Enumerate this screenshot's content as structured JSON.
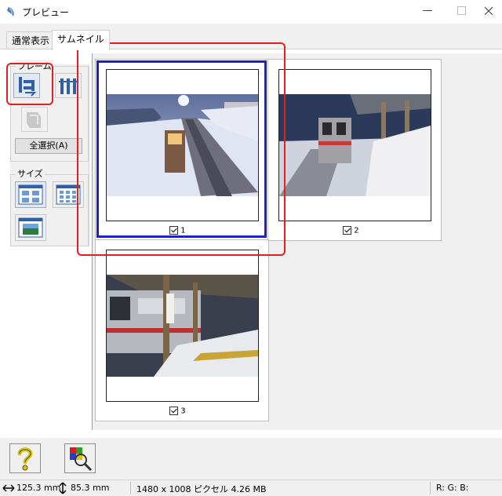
{
  "window": {
    "title": "プレビュー"
  },
  "tabs": [
    {
      "label": "通常表示",
      "active": false
    },
    {
      "label": "サムネイル",
      "active": true
    }
  ],
  "left_panel": {
    "frame_group_label": "フレーム",
    "select_all_label": "全選択(A)",
    "size_group_label": "サイズ"
  },
  "thumbnails": [
    {
      "number": "1",
      "checked": true,
      "selected": true
    },
    {
      "number": "2",
      "checked": true,
      "selected": false
    },
    {
      "number": "3",
      "checked": true,
      "selected": false
    }
  ],
  "status": {
    "width_value": "125.3 mm",
    "height_value": "85.3 mm",
    "image_info": "1480 x 1008 ピクセル 4.26 MB",
    "rgb_label": "R: G: B:"
  },
  "colors": {
    "selection_border": "#1f1fd1",
    "annotation_red": "#e02020"
  }
}
